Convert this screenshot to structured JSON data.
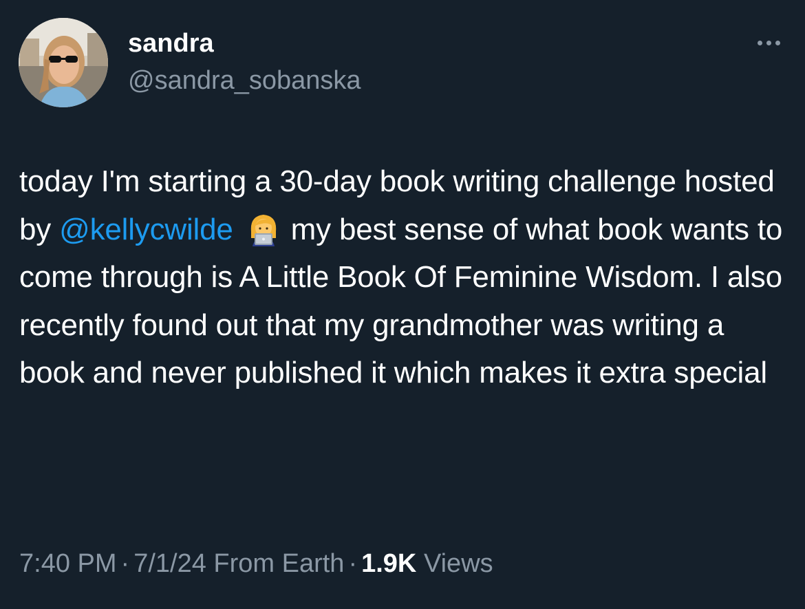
{
  "author": {
    "display_name": "sandra",
    "handle": "@sandra_sobanska"
  },
  "tweet": {
    "text_before_mention": "today I'm starting a 30-day book writing challenge hosted by ",
    "mention": "@kellycwilde",
    "emoji_icon": "woman-technologist-emoji",
    "text_after_mention": "my best sense of what book wants to come through is A Little Book Of Feminine Wisdom. I also recently found out that my grandmother was writing a book and never published it which makes it extra special"
  },
  "meta": {
    "time": "7:40 PM",
    "separator": "·",
    "date": "7/1/24",
    "source": "From Earth",
    "views_count": "1.9K",
    "views_label": "Views"
  },
  "colors": {
    "background": "#15202b",
    "text": "#ffffff",
    "secondary": "#8b98a5",
    "link": "#1d9bf0"
  }
}
